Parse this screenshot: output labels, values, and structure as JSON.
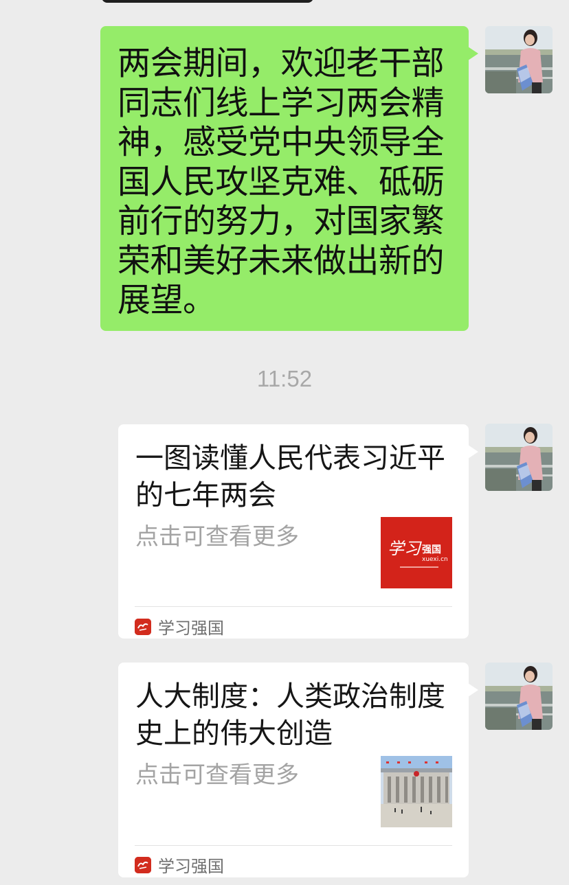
{
  "messages": {
    "text_message": "两会期间，欢迎老干部同志们线上学习两会精神，感受党中央领导全国人民攻坚克难、砥砺前行的努力，对国家繁荣和美好未来做出新的展望。",
    "timestamp": "11:52",
    "cards": [
      {
        "title": "一图读懂人民代表习近平的七年两会",
        "description": "点击可查看更多",
        "source": "学习强国",
        "thumbnail": {
          "logo_script": "学习",
          "logo_text": "强国",
          "domain": "xuexi.cn"
        }
      },
      {
        "title": "人大制度：人类政治制度史上的伟大创造",
        "description": "点击可查看更多",
        "source": "学习强国"
      }
    ]
  },
  "colors": {
    "background": "#ececec",
    "sent_bubble": "#95ec69",
    "card_background": "#ffffff",
    "source_icon": "#d22c1e",
    "timestamp_text": "#a8a8a8"
  },
  "icons": {
    "avatar": "user-avatar-photo",
    "source": "xuexi-qiangguo-logo-icon"
  }
}
